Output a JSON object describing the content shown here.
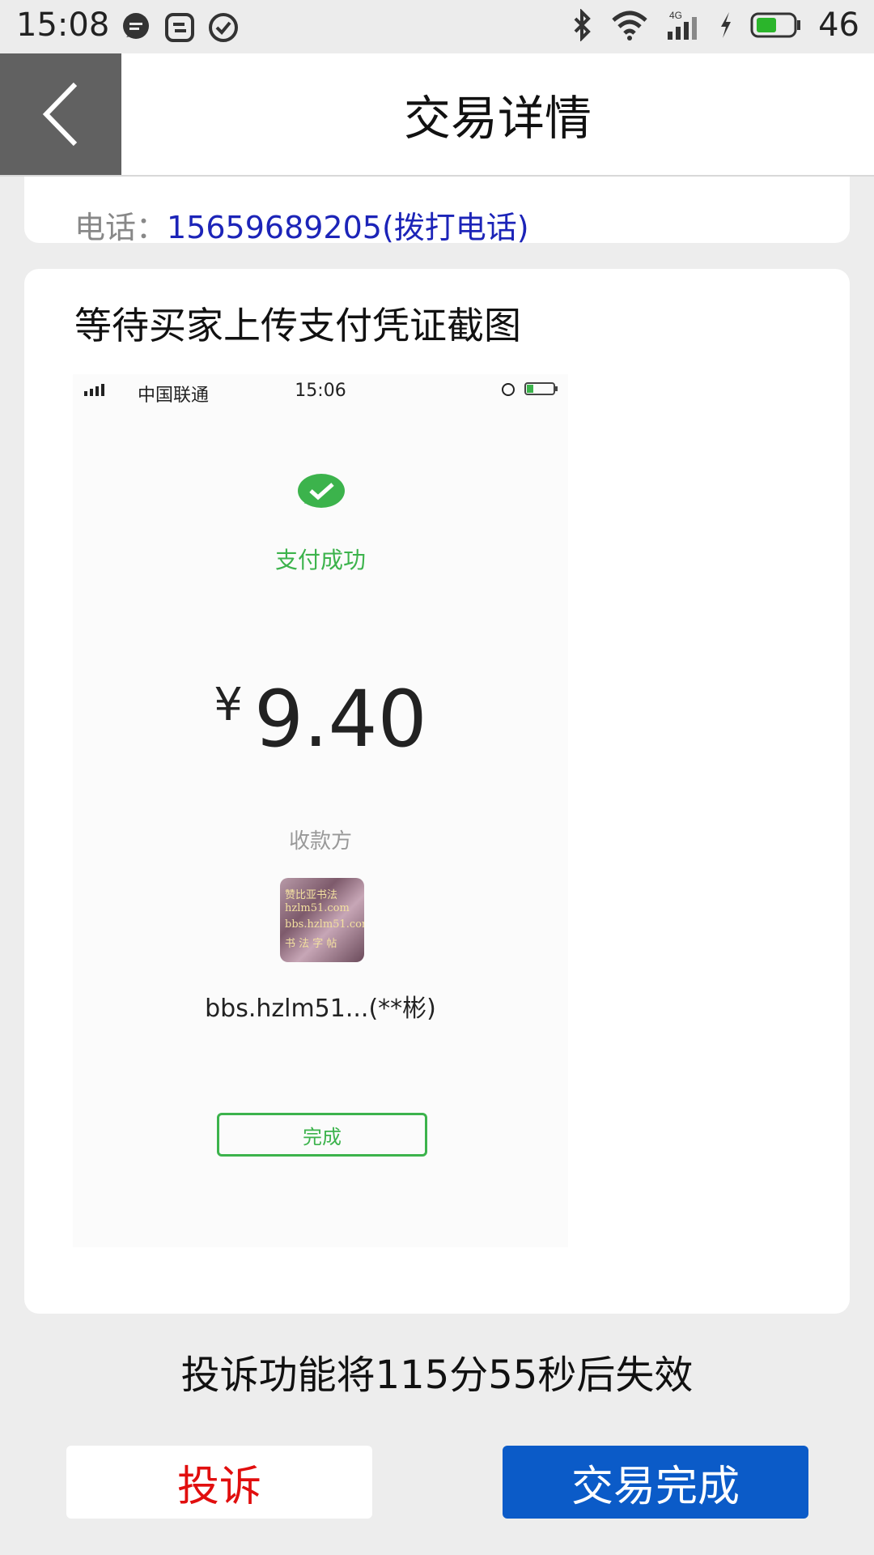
{
  "status_bar": {
    "time": "15:08",
    "battery_level": "46",
    "icons": [
      "chat-icon",
      "sync-icon",
      "check-circle-icon",
      "bluetooth-icon",
      "wifi-icon",
      "cellular-4g-icon",
      "charging-icon",
      "battery-icon"
    ]
  },
  "header": {
    "title": "交易详情",
    "back_icon": "chevron-left-icon"
  },
  "contact": {
    "label": "电话：",
    "phone": "15659689205(拨打电话)"
  },
  "main": {
    "status_text": "等待买家上传支付凭证截图",
    "screenshot": {
      "carrier": "中国联通",
      "time": "15:06",
      "success_text": "支付成功",
      "currency": "¥",
      "amount": "9.40",
      "payee_label": "收款方",
      "payee_name": "bbs.hzlm51...(**彬)",
      "done_label": "完成",
      "accent_color": "#3cb34c"
    }
  },
  "countdown_text": "投诉功能将115分55秒后失效",
  "actions": {
    "complain_label": "投诉",
    "complete_label": "交易完成",
    "complain_color": "#e10e0e",
    "complete_color": "#0b5bc8"
  }
}
